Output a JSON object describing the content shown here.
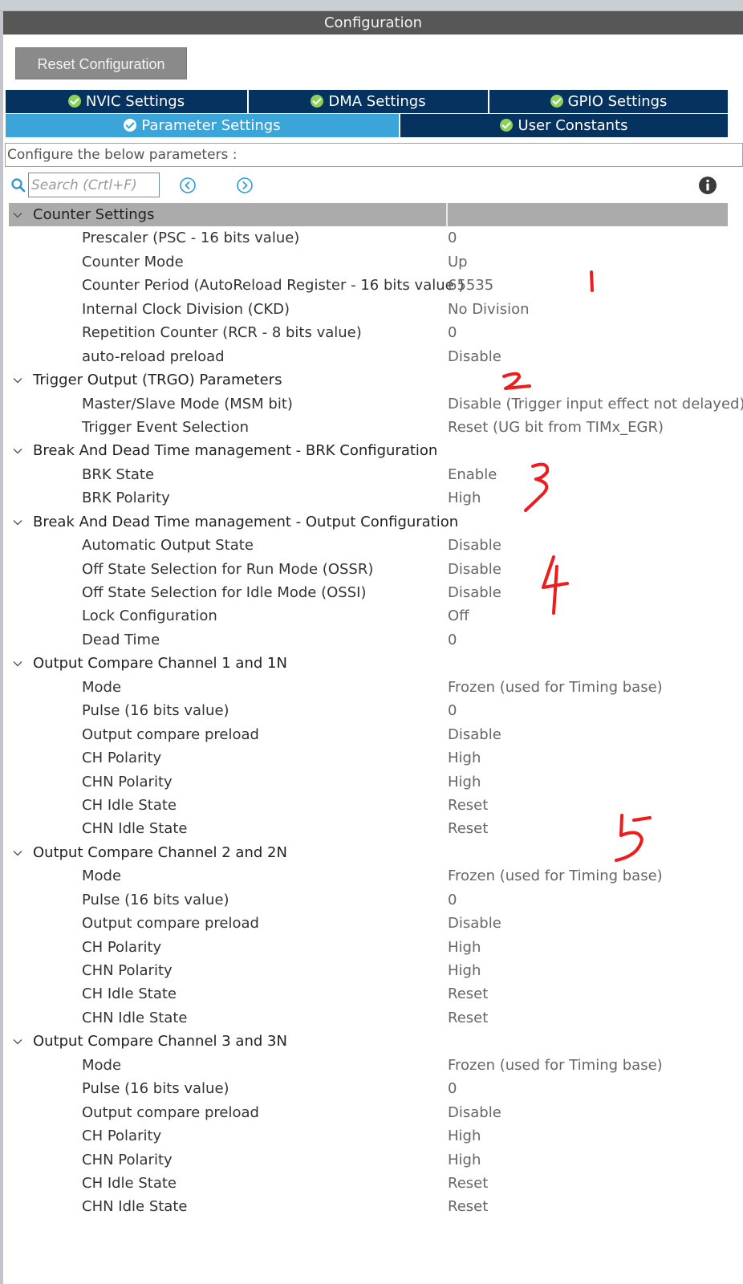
{
  "window": {
    "title": "Configuration"
  },
  "toolbar": {
    "reset_label": "Reset Configuration"
  },
  "tabs": {
    "row1": [
      {
        "label": "NVIC Settings"
      },
      {
        "label": "DMA Settings"
      },
      {
        "label": "GPIO Settings"
      }
    ],
    "row2": [
      {
        "label": "Parameter Settings",
        "active": true
      },
      {
        "label": "User Constants"
      }
    ]
  },
  "description": "Configure the below parameters :",
  "search": {
    "placeholder": "Search (Crtl+F)",
    "value": ""
  },
  "icons": {
    "search": "search-icon",
    "prev": "arrow-left-circle-icon",
    "next": "arrow-right-circle-icon",
    "info": "info-icon",
    "expand": "chevron-down-icon",
    "tab_check": "check-circle-icon"
  },
  "colors": {
    "title_bar": "#575757",
    "tab_dark": "#05325e",
    "tab_active": "#3ba4d9",
    "check": "#8ed15a",
    "section_header": "#ababab",
    "annotation": "#ee1c1c"
  },
  "sections": [
    {
      "title": "Counter Settings",
      "params": [
        {
          "name": "Prescaler (PSC - 16 bits value)",
          "value": "0"
        },
        {
          "name": "Counter Mode",
          "value": "Up"
        },
        {
          "name": "Counter Period (AutoReload Register - 16 bits value )",
          "value": "65535"
        },
        {
          "name": "Internal Clock Division (CKD)",
          "value": "No Division"
        },
        {
          "name": "Repetition Counter (RCR - 8 bits value)",
          "value": "0"
        },
        {
          "name": "auto-reload preload",
          "value": "Disable"
        }
      ]
    },
    {
      "title": "Trigger Output (TRGO) Parameters",
      "params": [
        {
          "name": "Master/Slave Mode (MSM bit)",
          "value": "Disable (Trigger input effect not delayed)"
        },
        {
          "name": "Trigger Event Selection",
          "value": "Reset (UG bit from TIMx_EGR)"
        }
      ]
    },
    {
      "title": "Break And Dead Time management - BRK Configuration",
      "params": [
        {
          "name": "BRK State",
          "value": "Enable"
        },
        {
          "name": "BRK Polarity",
          "value": "High"
        }
      ]
    },
    {
      "title": "Break And Dead Time management - Output Configuration",
      "params": [
        {
          "name": "Automatic Output State",
          "value": "Disable"
        },
        {
          "name": "Off State Selection for Run Mode (OSSR)",
          "value": "Disable"
        },
        {
          "name": "Off State Selection for Idle Mode (OSSI)",
          "value": "Disable"
        },
        {
          "name": "Lock Configuration",
          "value": "Off"
        },
        {
          "name": "Dead Time",
          "value": "0"
        }
      ]
    },
    {
      "title": "Output Compare Channel 1 and 1N",
      "params": [
        {
          "name": "Mode",
          "value": "Frozen (used for Timing base)"
        },
        {
          "name": "Pulse (16 bits value)",
          "value": "0"
        },
        {
          "name": "Output compare preload",
          "value": "Disable"
        },
        {
          "name": "CH Polarity",
          "value": "High"
        },
        {
          "name": "CHN Polarity",
          "value": "High"
        },
        {
          "name": "CH Idle State",
          "value": "Reset"
        },
        {
          "name": "CHN Idle State",
          "value": "Reset"
        }
      ]
    },
    {
      "title": "Output Compare Channel 2 and 2N",
      "params": [
        {
          "name": "Mode",
          "value": "Frozen (used for Timing base)"
        },
        {
          "name": "Pulse (16 bits value)",
          "value": "0"
        },
        {
          "name": "Output compare preload",
          "value": "Disable"
        },
        {
          "name": "CH Polarity",
          "value": "High"
        },
        {
          "name": "CHN Polarity",
          "value": "High"
        },
        {
          "name": "CH Idle State",
          "value": "Reset"
        },
        {
          "name": "CHN Idle State",
          "value": "Reset"
        }
      ]
    },
    {
      "title": "Output Compare Channel 3 and 3N",
      "params": [
        {
          "name": "Mode",
          "value": "Frozen (used for Timing base)"
        },
        {
          "name": "Pulse (16 bits value)",
          "value": "0"
        },
        {
          "name": "Output compare preload",
          "value": "Disable"
        },
        {
          "name": "CH Polarity",
          "value": "High"
        },
        {
          "name": "CHN Polarity",
          "value": "High"
        },
        {
          "name": "CH Idle State",
          "value": "Reset"
        },
        {
          "name": "CHN Idle State",
          "value": "Reset"
        }
      ]
    }
  ],
  "annotations": [
    "1",
    "2",
    "3",
    "4",
    "5"
  ]
}
